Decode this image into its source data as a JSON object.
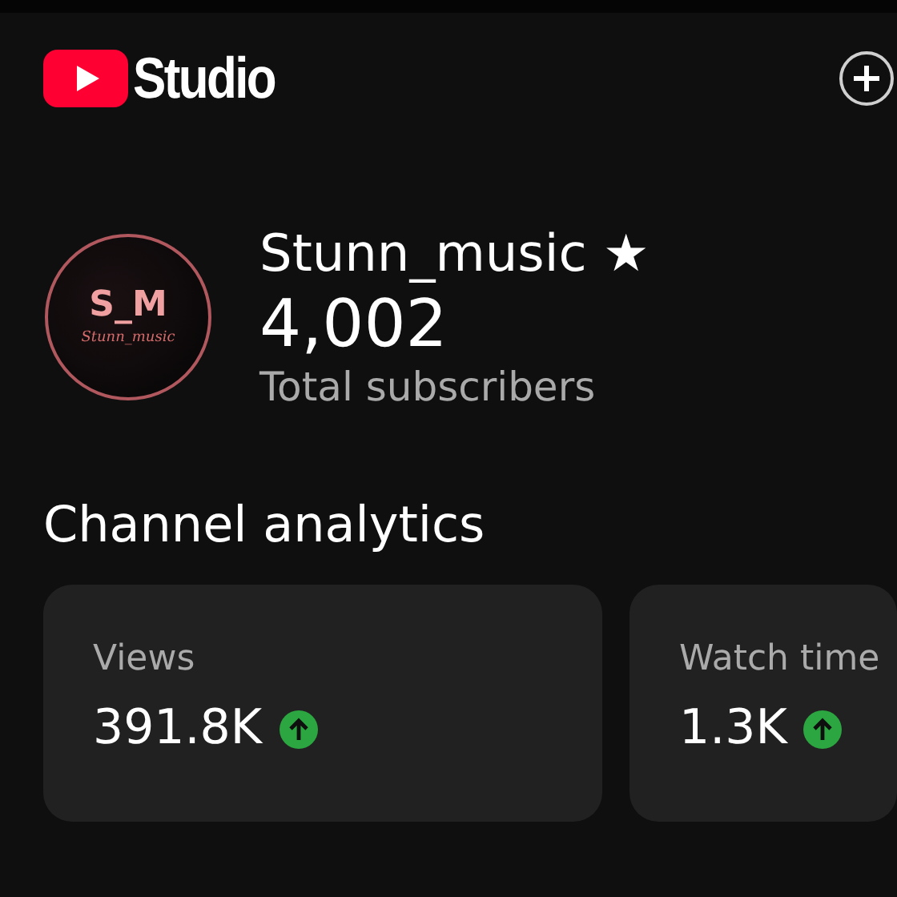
{
  "header": {
    "title": "Studio"
  },
  "channel": {
    "avatar_text": "S_M",
    "avatar_script": "Stunn_music",
    "name": "Stunn_music ★",
    "subscribers": "4,002",
    "subscribers_label": "Total subscribers"
  },
  "analytics": {
    "title": "Channel analytics",
    "cards": [
      {
        "label": "Views",
        "value": "391.8K",
        "rising": true
      },
      {
        "label": "Watch time",
        "value": "1.3K",
        "rising": true
      }
    ]
  }
}
